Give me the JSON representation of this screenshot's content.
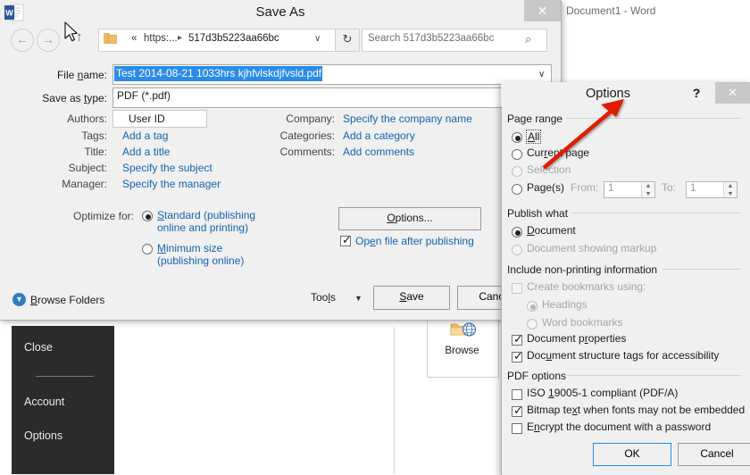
{
  "word": {
    "document_title": "Document1 - Word",
    "backstage": {
      "items": [
        {
          "label": "Close",
          "name": "close"
        },
        {
          "label": "Account",
          "name": "account"
        },
        {
          "label": "Options",
          "name": "options"
        }
      ],
      "browse_tile_label": "Browse"
    }
  },
  "save_as": {
    "title": "Save As",
    "close_label": "✕",
    "nav": {
      "back": "←",
      "forward": "→",
      "up": "↑",
      "refresh": "↻"
    },
    "address": {
      "separator": "«",
      "root": "https:...",
      "chevron": "▸",
      "folder": "517d3b5223aa66bc",
      "dropdown": "∨"
    },
    "search": {
      "placeholder": "Search 517d3b5223aa66bc",
      "value": "Search 517d3b5223aa66bc",
      "icon": "⌕"
    },
    "file_name": {
      "label": "File name:",
      "value": "Test 2014-08-21 1033hrs kjhfvlskdjfvsld.pdf",
      "dropdown": "∨"
    },
    "save_as_type": {
      "label": "Save as type:",
      "value": "PDF (*.pdf)"
    },
    "metadata_left": [
      {
        "label": "Authors:",
        "value": "User ID",
        "style": "boxed"
      },
      {
        "label": "Tags:",
        "value": "Add a tag",
        "style": "link"
      },
      {
        "label": "Title:",
        "value": "Add a title",
        "style": "link"
      },
      {
        "label": "Subject:",
        "value": "Specify the subject",
        "style": "link"
      },
      {
        "label": "Manager:",
        "value": "Specify the manager",
        "style": "link"
      }
    ],
    "metadata_right": [
      {
        "label": "Company:",
        "value": "Specify the company name",
        "style": "link"
      },
      {
        "label": "Categories:",
        "value": "Add a category",
        "style": "link"
      },
      {
        "label": "Comments:",
        "value": "Add comments",
        "style": "link"
      }
    ],
    "optimize": {
      "label": "Optimize for:",
      "options": [
        {
          "line1": "Standard (publishing",
          "line2": "online and printing)",
          "selected": true
        },
        {
          "line1": "Minimum size",
          "line2": "(publishing online)",
          "selected": false
        }
      ]
    },
    "options_button": "Options...",
    "open_after_publishing": {
      "label": "Open file after publishing",
      "checked": true
    },
    "browse_folders": {
      "label": "Browse Folders",
      "icon": "▼"
    },
    "tools": {
      "label": "Tools",
      "arrow": "▼"
    },
    "save_button": "Save",
    "cancel_button": "Cancel"
  },
  "options_dialog": {
    "title": "Options",
    "help_label": "?",
    "close_label": "✕",
    "page_range": {
      "header": "Page range",
      "options": [
        {
          "label": "All",
          "selected": true,
          "disabled": false,
          "focused": true
        },
        {
          "label": "Current page",
          "selected": false,
          "disabled": false,
          "focused": false
        },
        {
          "label": "Selection",
          "selected": false,
          "disabled": true,
          "focused": false
        },
        {
          "label": "Page(s)",
          "selected": false,
          "disabled": false,
          "focused": false
        }
      ],
      "from_label": "From:",
      "from_value": "1",
      "to_label": "To:",
      "to_value": "1"
    },
    "publish_what": {
      "header": "Publish what",
      "options": [
        {
          "label": "Document",
          "selected": true,
          "disabled": false
        },
        {
          "label": "Document showing markup",
          "selected": false,
          "disabled": true
        }
      ]
    },
    "non_printing": {
      "header": "Include non-printing information",
      "items": [
        {
          "type": "checkbox",
          "label": "Create bookmarks using:",
          "checked": false,
          "disabled": true
        },
        {
          "type": "radio",
          "label": "Headings",
          "checked": true,
          "disabled": true
        },
        {
          "type": "radio",
          "label": "Word bookmarks",
          "checked": false,
          "disabled": true
        },
        {
          "type": "checkbox",
          "label": "Document properties",
          "checked": true,
          "disabled": false
        },
        {
          "type": "checkbox",
          "label": "Document structure tags for accessibility",
          "checked": true,
          "disabled": false
        }
      ]
    },
    "pdf_options": {
      "header": "PDF options",
      "items": [
        {
          "label": "ISO 19005-1 compliant (PDF/A)",
          "checked": false
        },
        {
          "label": "Bitmap text when fonts may not be embedded",
          "checked": true
        },
        {
          "label": "Encrypt the document with a password",
          "checked": false
        }
      ]
    },
    "ok_button": "OK",
    "cancel_button": "Cancel"
  },
  "colors": {
    "selection_blue": "#2a8ce8",
    "link_blue": "#1364b0",
    "dialog_bg": "#f0f0f0",
    "backstage_dark": "#2b2b2b",
    "annotation_red": "#e01b00"
  }
}
